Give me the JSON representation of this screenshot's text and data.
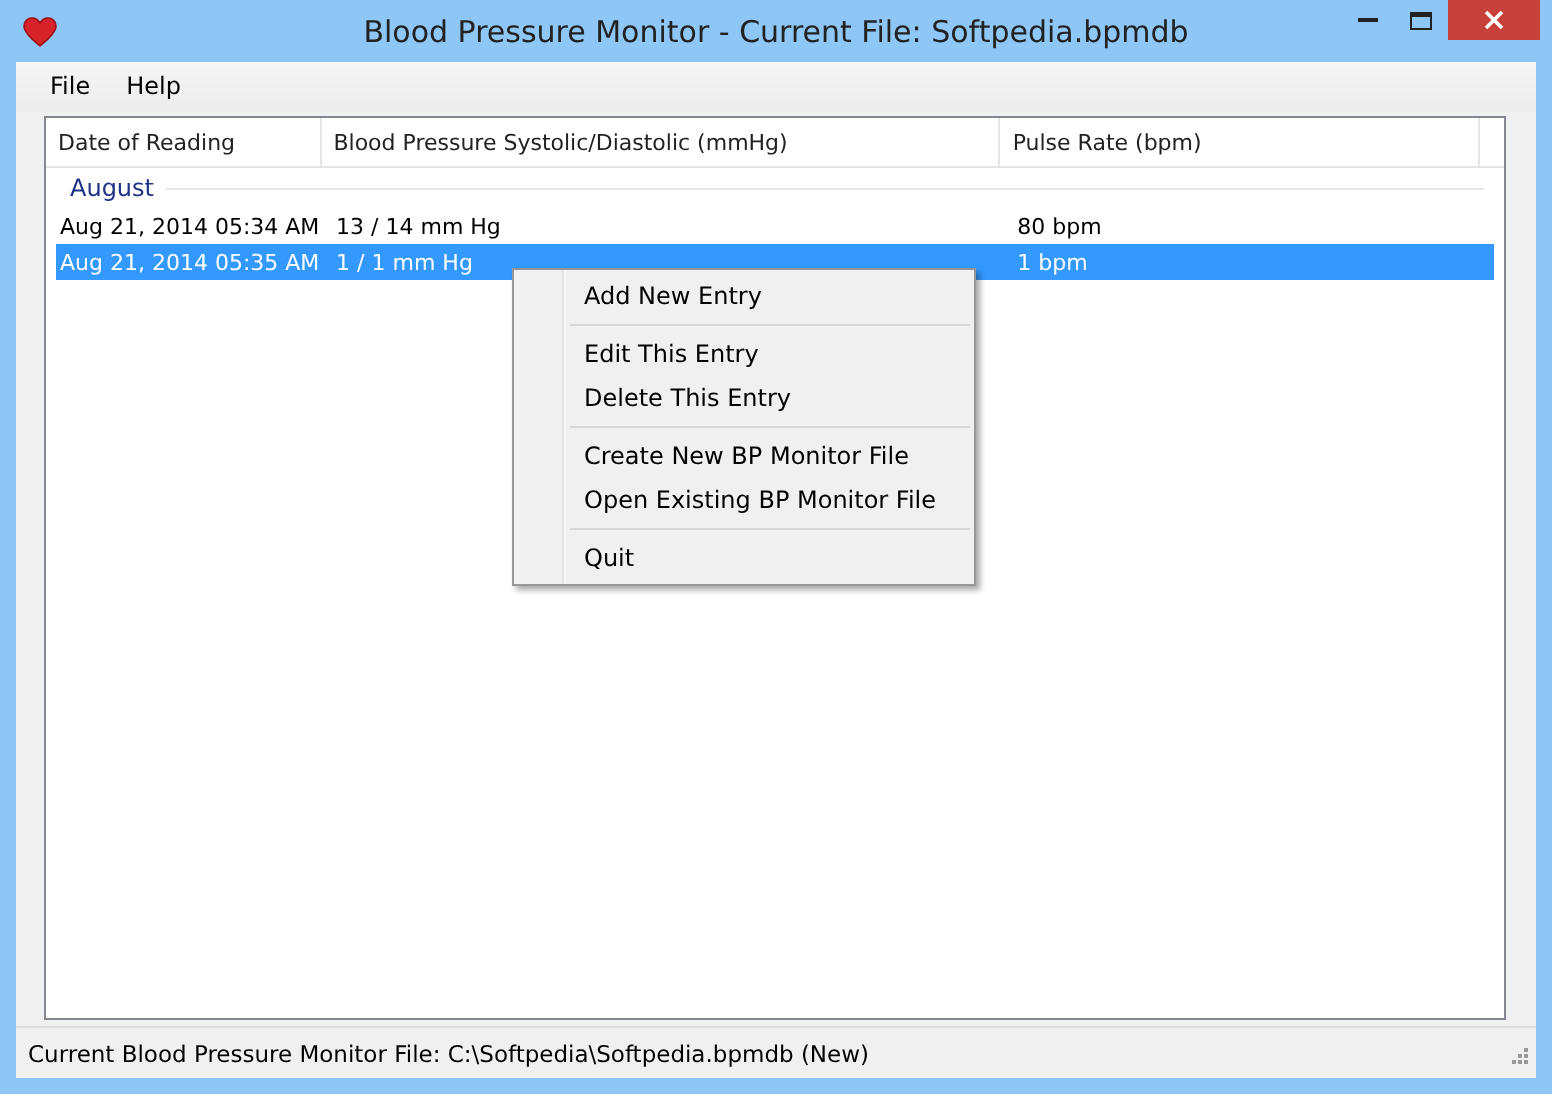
{
  "window": {
    "title": "Blood Pressure Monitor - Current File: Softpedia.bpmdb"
  },
  "menu": [
    "File",
    "Help"
  ],
  "table": {
    "columns": [
      "Date of Reading",
      "Blood Pressure Systolic/Diastolic (mmHg)",
      "Pulse Rate (bpm)"
    ],
    "groups": [
      {
        "label": "August",
        "rows": [
          {
            "cells": [
              "Aug 21, 2014 05:34 AM",
              "13 / 14 mm Hg",
              "80 bpm"
            ],
            "selected": false
          },
          {
            "cells": [
              "Aug 21, 2014 05:35 AM",
              "1 / 1 mm Hg",
              "1 bpm"
            ],
            "selected": true
          }
        ]
      }
    ]
  },
  "context_menu": {
    "groups": [
      [
        "Add New Entry"
      ],
      [
        "Edit This Entry",
        "Delete This Entry"
      ],
      [
        "Create New BP Monitor File",
        "Open Existing BP Monitor File"
      ],
      [
        "Quit"
      ]
    ]
  },
  "status_bar": "Current Blood Pressure Monitor File: C:\\Softpedia\\Softpedia.bpmdb (New)"
}
